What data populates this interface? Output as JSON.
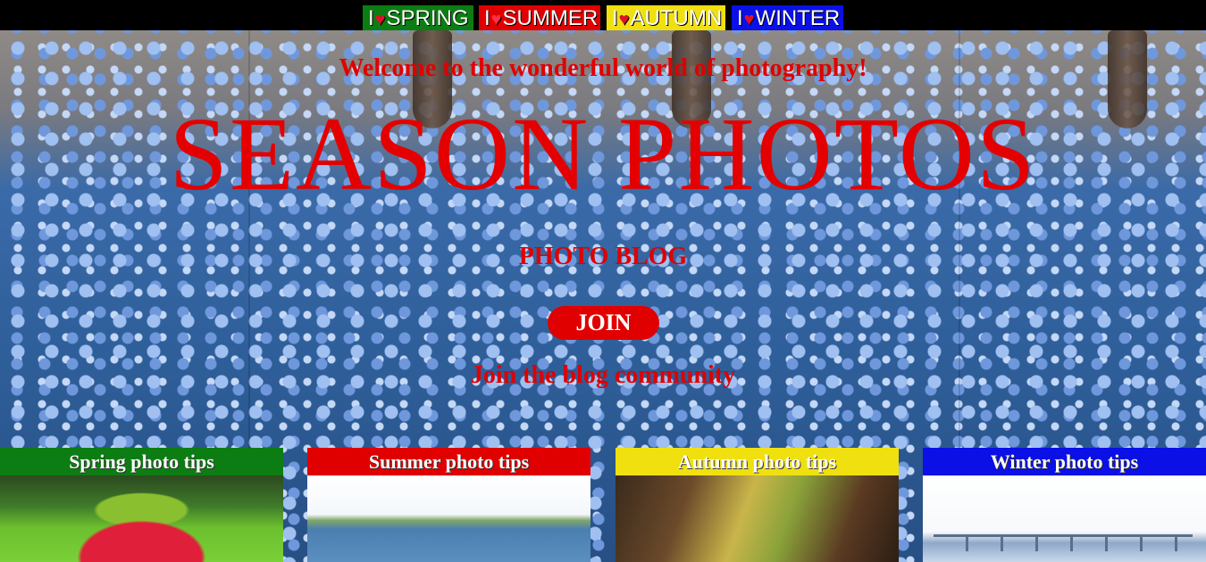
{
  "nav": {
    "tabs": [
      {
        "prefix": "I",
        "label": "SPRING"
      },
      {
        "prefix": "I",
        "label": "SUMMER"
      },
      {
        "prefix": "I",
        "label": "AUTUMN"
      },
      {
        "prefix": "I",
        "label": "WINTER"
      }
    ]
  },
  "hero": {
    "welcome": "Welcome to the wonderful world of photography!",
    "title": "SEASON PHOTOS",
    "subtitle": "PHOTO BLOG",
    "join_label": "JOIN",
    "join_text": "Join the blog community"
  },
  "tips": [
    {
      "label": "Spring photo tips"
    },
    {
      "label": "Summer photo tips"
    },
    {
      "label": "Autumn photo tips"
    },
    {
      "label": "Winter photo tips"
    }
  ],
  "colors": {
    "spring": "#0c7d12",
    "summer": "#e00000",
    "autumn": "#f0e010",
    "winter": "#0a10e6",
    "accent_text": "#e00000"
  },
  "icons": {
    "heart": "heart-icon"
  }
}
